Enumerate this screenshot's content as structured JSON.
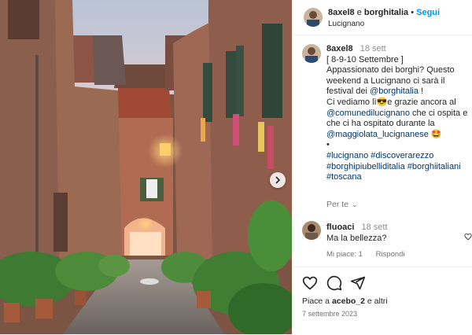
{
  "header": {
    "username": "8axel8",
    "conjunction": "e",
    "collaborator": "borghitalia",
    "separator": "•",
    "follow_label": "Segui",
    "location": "Lucignano"
  },
  "caption": {
    "username": "8axel8",
    "time": "18 sett",
    "line1": "[ 8-9-10 Settembre ]",
    "line2": "Appassionato dei borghi? Questo weekend a Lucignano ci sarà il festival dei",
    "mention1": "@borghitalia",
    "line2_end": "!",
    "line3_start": "Ci vediamo lì",
    "emoji_sunglasses": "😎",
    "line3_mid": "e grazie ancora al",
    "mention2": "@comunedilucignano",
    "line3_end": "che ci ospita e che ci ha ospitato durante la",
    "mention3": "@maggiolata_lucignanese",
    "emoji_heart_eyes": "🤩",
    "bullet": "•",
    "tags1": "#lucignano #discoverarezzo",
    "tags2": "#borghipiubelliditalia #borghiitaliani",
    "tags3": "#toscana"
  },
  "see_translation": {
    "label": "Per te",
    "chevron": "⌄"
  },
  "comment": {
    "username": "fluoaci",
    "time": "18 sett",
    "text": "Ma la bellezza?",
    "likes_label": "Mi piace: 1",
    "reply_label": "Rispondi"
  },
  "footer": {
    "likes_prefix": "Piace a",
    "likes_user": "acebo_2",
    "likes_suffix": "e altri",
    "date": "7 settembre 2023"
  },
  "icons": {
    "heart": "heart-icon",
    "comment": "comment-icon",
    "share": "share-icon",
    "next": "chevron-right-icon"
  },
  "colors": {
    "link_blue": "#0095f6",
    "tag_blue": "#00376b",
    "muted": "#737373"
  }
}
